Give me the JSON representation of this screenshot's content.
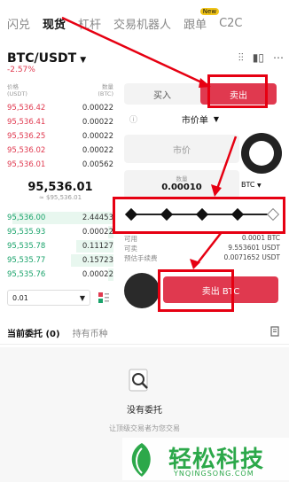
{
  "tabs": [
    "闪兑",
    "现货",
    "杠杆",
    "交易机器人",
    "跟单",
    "C2C"
  ],
  "new_badge": "New",
  "pair": "BTC/USDT",
  "change": "-2.57%",
  "orderbook": {
    "price_header": "价格\n(USDT)",
    "qty_header": "数量\n(BTC)",
    "asks": [
      {
        "price": "95,536.42",
        "qty": "0.00022"
      },
      {
        "price": "95,536.41",
        "qty": "0.00022"
      },
      {
        "price": "95,536.25",
        "qty": "0.00022"
      },
      {
        "price": "95,536.02",
        "qty": "0.00022"
      },
      {
        "price": "95,536.01",
        "qty": "0.00562"
      }
    ],
    "mid_price": "95,536.01",
    "mid_sub": "≈ $95,536.01",
    "bids": [
      {
        "price": "95,536.00",
        "qty": "2.44453",
        "depth": 0.95
      },
      {
        "price": "95,535.93",
        "qty": "0.00022",
        "depth": 0.05
      },
      {
        "price": "95,535.78",
        "qty": "0.11127",
        "depth": 0.35
      },
      {
        "price": "95,535.77",
        "qty": "0.15723",
        "depth": 0.4
      },
      {
        "price": "95,535.76",
        "qty": "0.00022",
        "depth": 0.05
      }
    ],
    "depth_value": "0.01"
  },
  "form": {
    "buy_label": "买入",
    "sell_label": "卖出",
    "order_type": "市价单",
    "price_placeholder": "市价",
    "qty_label": "数量",
    "qty_value": "0.00010",
    "unit": "BTC",
    "info": [
      {
        "k": "可用",
        "v": "0.0001 BTC"
      },
      {
        "k": "可卖",
        "v": "9.553601 USDT"
      },
      {
        "k": "预估手续费",
        "v": "0.0071652 USDT"
      }
    ],
    "submit_label": "卖出 BTC"
  },
  "bottom_tabs": [
    "当前委托 (0)",
    "持有币种"
  ],
  "empty_title": "没有委托",
  "empty_sub": "让顶级交易者为您交易",
  "watermark": {
    "text": "轻松科技",
    "sub": "YNQINGSONG.COM"
  },
  "colors": {
    "sell": "#e0394f",
    "buy": "#1aa36b",
    "annotation": "#e60012"
  }
}
